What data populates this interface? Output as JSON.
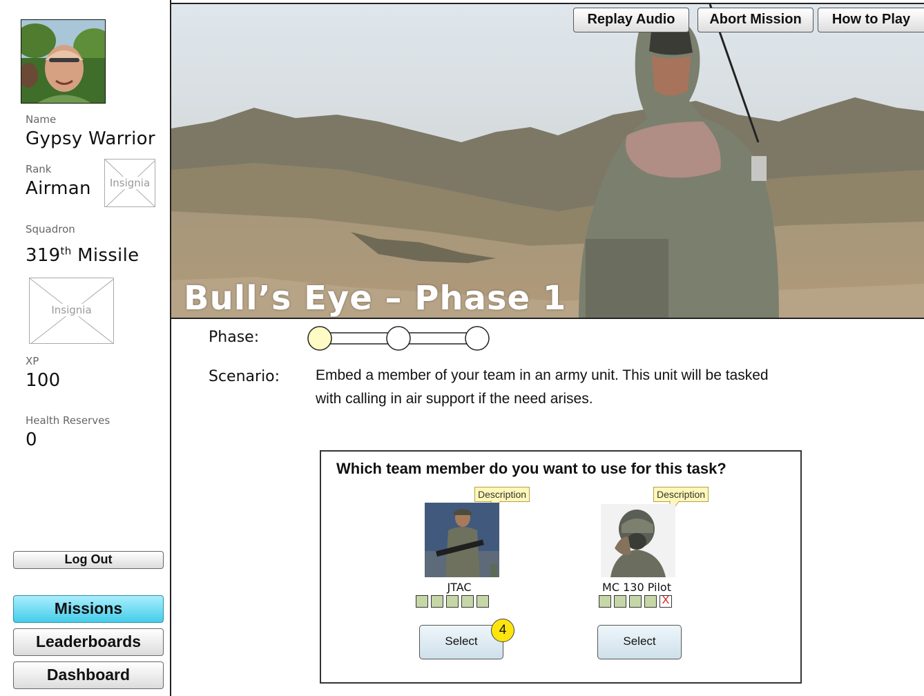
{
  "profile": {
    "name_label": "Name",
    "name": "Gypsy Warrior",
    "rank_label": "Rank",
    "rank": "Airman",
    "rank_insignia": "Insignia",
    "squadron_label": "Squadron",
    "squadron_number": "319",
    "squadron_suffix": "th",
    "squadron_name": " Missile",
    "squadron_insignia": "Insignia",
    "xp_label": "XP",
    "xp": "100",
    "health_label": "Health Reserves",
    "health": "0"
  },
  "sidebar_buttons": {
    "logout": "Log Out",
    "missions": "Missions",
    "leaderboards": "Leaderboards",
    "dashboard": "Dashboard"
  },
  "top_buttons": {
    "replay": "Replay Audio",
    "abort": "Abort Mission",
    "howto": "How to Play"
  },
  "mission": {
    "title": "Bull’s Eye – Phase 1",
    "phase_label": "Phase:",
    "current_phase": 1,
    "phase_count": 3,
    "scenario_label": "Scenario:",
    "scenario_text": "Embed a member of your team in an army unit. This unit will be tasked with calling in air support if the need arises."
  },
  "task": {
    "question": "Which team member do you want to use for this task?",
    "members": [
      {
        "name": "JTAC",
        "tooltip": "Description",
        "select_label": "Select",
        "health": 5,
        "health_max": 5,
        "marker": "4"
      },
      {
        "name": "MC 130 Pilot",
        "tooltip": "Description",
        "select_label": "Select",
        "health": 4,
        "health_max": 5,
        "lost_mark": "X"
      }
    ]
  },
  "colors": {
    "active_button": "#45cdea",
    "phase_current": "#fffbc4",
    "health_box": "#c5d7a6",
    "marker": "#ffe50e",
    "tooltip_bg": "#fff8b8"
  }
}
